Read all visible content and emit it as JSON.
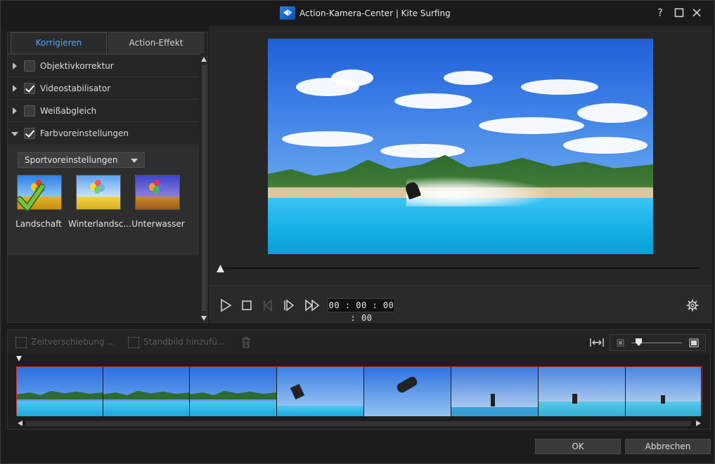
{
  "window": {
    "title": "Action-Kamera-Center  |  Kite Surfing",
    "help_icon": "question-mark-icon",
    "maximize_icon": "maximize-icon",
    "close_icon": "close-icon"
  },
  "left_panel": {
    "tabs": [
      {
        "label": "Korrigieren",
        "active": true
      },
      {
        "label": "Action-Effekt",
        "active": false
      }
    ],
    "sections": [
      {
        "label": "Objektivkorrektur",
        "checked": false,
        "expanded": false
      },
      {
        "label": "Videostabilisator",
        "checked": true,
        "expanded": false
      },
      {
        "label": "Weißabgleich",
        "checked": false,
        "expanded": false
      },
      {
        "label": "Farbvoreinstellungen",
        "checked": true,
        "expanded": true
      }
    ],
    "preset_dropdown": {
      "selected": "Sportvoreinstellungen"
    },
    "presets": [
      {
        "label": "Landschaft",
        "selected": true
      },
      {
        "label": "Winterlandsc...",
        "selected": false
      },
      {
        "label": "Unterwasser",
        "selected": false
      }
    ]
  },
  "player": {
    "timecode": "00 : 00 : 00 : 00",
    "seek_position": 0,
    "controls": [
      "play-icon",
      "stop-icon",
      "previous-frame-icon",
      "next-frame-icon",
      "fast-forward-icon"
    ],
    "settings_icon": "gear-icon"
  },
  "timeline": {
    "toolbar": {
      "time_shift": "Zeitverschiebung ...",
      "freeze_frame": "Standbild hinzufü...",
      "delete_icon": "trash-icon",
      "fit_icon": "fit-to-timeline-icon"
    },
    "zoom_level": 0.15,
    "frame_count": 8
  },
  "footer": {
    "ok": "OK",
    "cancel": "Abbrechen"
  },
  "colors": {
    "accent": "#4ea3ff",
    "background": "#1c1c1c",
    "panel": "#242424",
    "check_green": "#7cc242"
  }
}
